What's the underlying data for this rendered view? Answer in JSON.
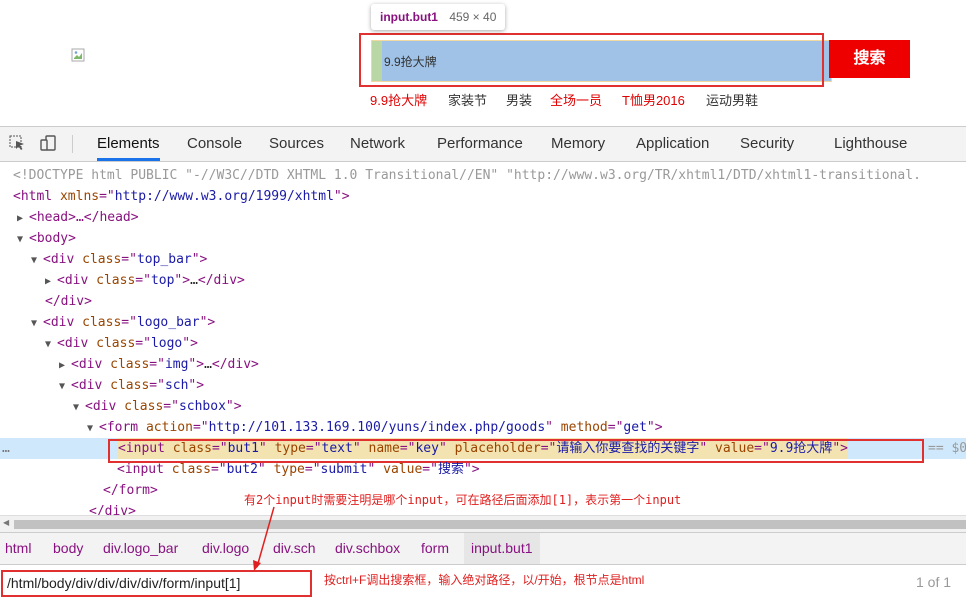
{
  "page": {
    "tooltip": {
      "selector": "input.but1",
      "size": "459 × 40"
    },
    "search_value": "9.9抢大牌",
    "search_button": "搜索",
    "hot_links": [
      {
        "text": "9.9抢大牌",
        "color": "#e00000"
      },
      {
        "text": "家装节",
        "color": "#333333"
      },
      {
        "text": "男装",
        "color": "#333333"
      },
      {
        "text": "全场一员",
        "color": "#e00000"
      },
      {
        "text": "T恤男2016",
        "color": "#e00000"
      },
      {
        "text": "运动男鞋",
        "color": "#333333"
      }
    ]
  },
  "devtools": {
    "tabs": [
      "Elements",
      "Console",
      "Sources",
      "Network",
      "Performance",
      "Memory",
      "Application",
      "Security",
      "Lighthouse"
    ],
    "active_tab": "Elements",
    "tree": {
      "doctype": "<!DOCTYPE html PUBLIC \"-//W3C//DTD XHTML 1.0 Transitional//EN\" \"http://www.w3.org/TR/xhtml1/DTD/xhtml1-transitional.",
      "html_open": "html",
      "html_attr": "xmlns",
      "html_val": "http://www.w3.org/1999/xhtml",
      "head": "<head>…</head>",
      "body": "body",
      "top_bar_class": "top_bar",
      "top_class": "top",
      "logo_bar_class": "logo_bar",
      "logo_class": "logo",
      "img_class": "img",
      "sch_class": "sch",
      "schbox_class": "schbox",
      "form_action": "http://101.133.169.100/yuns/index.php/goods",
      "form_method": "get",
      "input1_class": "but1",
      "input1_type": "text",
      "input1_name": "key",
      "input1_placeholder": "请输入你要查找的关键字",
      "input1_value": "9.9抢大牌",
      "input2_class": "but2",
      "input2_type": "submit",
      "input2_value": "搜索",
      "eq": "== $0",
      "dots": "…"
    },
    "breadcrumbs": [
      "html",
      "body",
      "div.logo_bar",
      "div.logo",
      "div.sch",
      "div.schbox",
      "form",
      "input.but1"
    ],
    "find": {
      "value": "/html/body/div/div/div/div/form/input[1]",
      "count": "1 of 1"
    }
  },
  "annotations": {
    "note1": "有2个input时需要注明是哪个input，可在路径后面添加[1]，表示第一个input",
    "note2": "按ctrl+F调出搜索框，输入绝对路径，以/开始，根节点是html"
  }
}
